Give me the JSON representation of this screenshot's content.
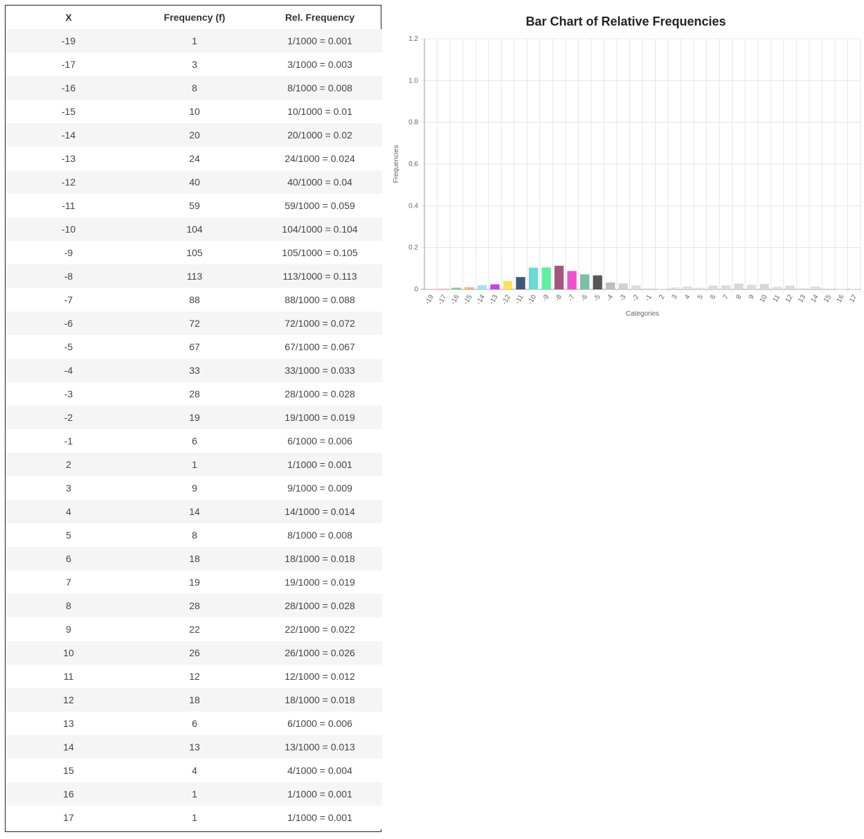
{
  "table": {
    "headers": [
      "X",
      "Frequency (f)",
      "Rel. Frequency"
    ],
    "rows": [
      [
        "-19",
        "1",
        "1/1000 = 0.001"
      ],
      [
        "-17",
        "3",
        "3/1000 = 0.003"
      ],
      [
        "-16",
        "8",
        "8/1000 = 0.008"
      ],
      [
        "-15",
        "10",
        "10/1000 = 0.01"
      ],
      [
        "-14",
        "20",
        "20/1000 = 0.02"
      ],
      [
        "-13",
        "24",
        "24/1000 = 0.024"
      ],
      [
        "-12",
        "40",
        "40/1000 = 0.04"
      ],
      [
        "-11",
        "59",
        "59/1000 = 0.059"
      ],
      [
        "-10",
        "104",
        "104/1000 = 0.104"
      ],
      [
        "-9",
        "105",
        "105/1000 = 0.105"
      ],
      [
        "-8",
        "113",
        "113/1000 = 0.113"
      ],
      [
        "-7",
        "88",
        "88/1000 = 0.088"
      ],
      [
        "-6",
        "72",
        "72/1000 = 0.072"
      ],
      [
        "-5",
        "67",
        "67/1000 = 0.067"
      ],
      [
        "-4",
        "33",
        "33/1000 = 0.033"
      ],
      [
        "-3",
        "28",
        "28/1000 = 0.028"
      ],
      [
        "-2",
        "19",
        "19/1000 = 0.019"
      ],
      [
        "-1",
        "6",
        "6/1000 = 0.006"
      ],
      [
        "2",
        "1",
        "1/1000 = 0.001"
      ],
      [
        "3",
        "9",
        "9/1000 = 0.009"
      ],
      [
        "4",
        "14",
        "14/1000 = 0.014"
      ],
      [
        "5",
        "8",
        "8/1000 = 0.008"
      ],
      [
        "6",
        "18",
        "18/1000 = 0.018"
      ],
      [
        "7",
        "19",
        "19/1000 = 0.019"
      ],
      [
        "8",
        "28",
        "28/1000 = 0.028"
      ],
      [
        "9",
        "22",
        "22/1000 = 0.022"
      ],
      [
        "10",
        "26",
        "26/1000 = 0.026"
      ],
      [
        "11",
        "12",
        "12/1000 = 0.012"
      ],
      [
        "12",
        "18",
        "18/1000 = 0.018"
      ],
      [
        "13",
        "6",
        "6/1000 = 0.006"
      ],
      [
        "14",
        "13",
        "13/1000 = 0.013"
      ],
      [
        "15",
        "4",
        "4/1000 = 0.004"
      ],
      [
        "16",
        "1",
        "1/1000 = 0.001"
      ],
      [
        "17",
        "1",
        "1/1000 = 0.001"
      ]
    ]
  },
  "chart_data": {
    "type": "bar",
    "title": "Bar Chart of Relative Frequencies",
    "xlabel": "Categories",
    "ylabel": "Frequencies",
    "ylim": [
      0,
      1.2
    ],
    "yticks": [
      0,
      0.2,
      0.4,
      0.6,
      0.8,
      1.0,
      1.2
    ],
    "ytick_labels": [
      "0",
      "0.2",
      "0.4",
      "0.6",
      "0.8",
      "1.0",
      "1.2"
    ],
    "grid": true,
    "legend": "none",
    "categories": [
      "-19",
      "-17",
      "-16",
      "-15",
      "-14",
      "-13",
      "-12",
      "-11",
      "-10",
      "-9",
      "-8",
      "-7",
      "-6",
      "-5",
      "-4",
      "-3",
      "-2",
      "-1",
      "2",
      "3",
      "4",
      "5",
      "6",
      "7",
      "8",
      "9",
      "10",
      "11",
      "12",
      "13",
      "14",
      "15",
      "16",
      "17"
    ],
    "values": [
      0.001,
      0.003,
      0.008,
      0.01,
      0.02,
      0.024,
      0.04,
      0.059,
      0.104,
      0.105,
      0.113,
      0.088,
      0.072,
      0.067,
      0.033,
      0.028,
      0.019,
      0.006,
      0.001,
      0.009,
      0.014,
      0.008,
      0.018,
      0.019,
      0.028,
      0.022,
      0.026,
      0.012,
      0.018,
      0.006,
      0.013,
      0.004,
      0.001,
      0.001
    ],
    "colors": [
      "#ff9aa2",
      "#f7a8b8",
      "#7ed08a",
      "#f7b27a",
      "#a8e0f0",
      "#cc44dd",
      "#ffe15a",
      "#3e5a78",
      "#6fd9d6",
      "#5ef0a0",
      "#a3577e",
      "#f050d0",
      "#7bbfa6",
      "#555555",
      "#bdbdbd",
      "#d2d2d2",
      "#dcdcdc",
      "#e2e2e2",
      "#e4e4e4",
      "#e0e0e0",
      "#dddddd",
      "#e2e2e2",
      "#dcdcdc",
      "#dcdcdc",
      "#d9d9d9",
      "#dcdcdc",
      "#d9d9d9",
      "#dedede",
      "#dcdcdc",
      "#e2e2e2",
      "#dddddd",
      "#e3e3e3",
      "#e6e6e6",
      "#e6e6e6"
    ]
  }
}
